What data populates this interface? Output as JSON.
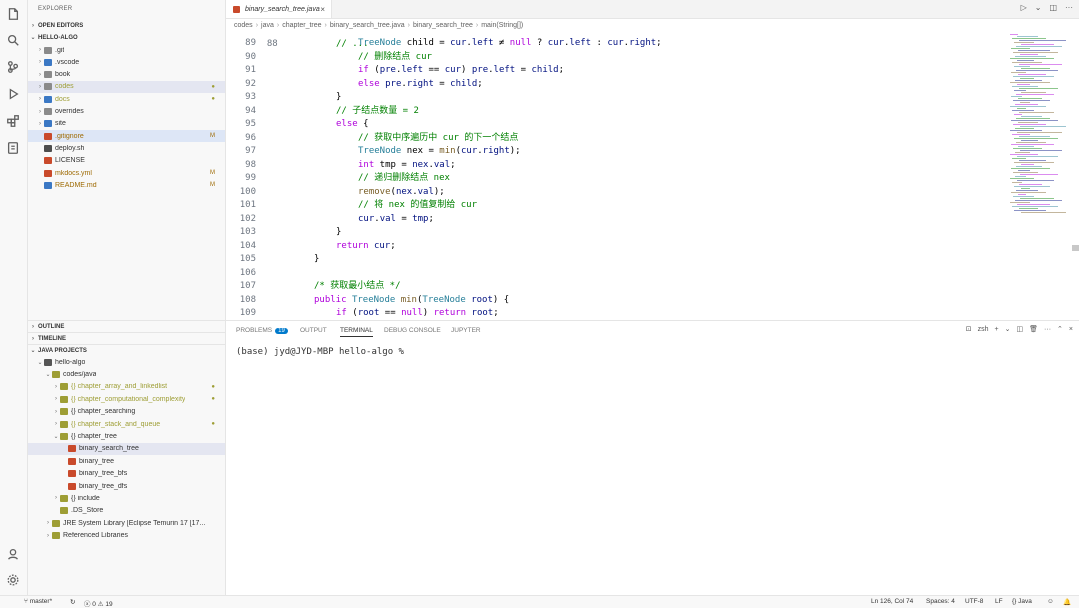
{
  "sidebar": {
    "title": "EXPLORER",
    "open_editors": "OPEN EDITORS",
    "root": "HELLO-ALGO",
    "files": [
      {
        "name": ".git",
        "kind": "folder",
        "badge": "",
        "color": "#8a8a8a",
        "badge_color": ""
      },
      {
        "name": ".vscode",
        "kind": "folder",
        "badge": "",
        "color": "#3b78c4",
        "badge_color": ""
      },
      {
        "name": "book",
        "kind": "folder",
        "badge": "",
        "color": "#8a8a8a",
        "badge_color": ""
      },
      {
        "name": "codes",
        "kind": "folder",
        "badge": "●",
        "color": "#8a8a8a",
        "badge_color": "#9e9e35"
      },
      {
        "name": "docs",
        "kind": "folder",
        "badge": "●",
        "color": "#3b78c4",
        "badge_color": "#9e9e35"
      },
      {
        "name": "overrides",
        "kind": "folder",
        "badge": "",
        "color": "#8a8a8a",
        "badge_color": ""
      },
      {
        "name": "site",
        "kind": "folder",
        "badge": "",
        "color": "#3b78c4",
        "badge_color": ""
      },
      {
        "name": ".gitignore",
        "kind": "file",
        "badge": "M",
        "color": "#c94a2b",
        "badge_color": "#9e6a03"
      },
      {
        "name": "deploy.sh",
        "kind": "file",
        "badge": "",
        "color": "#4d4d4d",
        "badge_color": ""
      },
      {
        "name": "LICENSE",
        "kind": "file",
        "badge": "",
        "color": "#c94a2b",
        "badge_color": ""
      },
      {
        "name": "mkdocs.yml",
        "kind": "file",
        "badge": "M",
        "color": "#c94a2b",
        "badge_color": "#9e6a03"
      },
      {
        "name": "README.md",
        "kind": "file",
        "badge": "M",
        "color": "#3b78c4",
        "badge_color": "#9e6a03"
      }
    ],
    "outline": "OUTLINE",
    "timeline": "TIMELINE",
    "java_projects": "JAVA PROJECTS",
    "projects": [
      {
        "name": "hello-algo",
        "level": 0,
        "chev": "⌄",
        "badge": ""
      },
      {
        "name": "codes/java",
        "level": 1,
        "chev": "⌄",
        "badge": ""
      },
      {
        "name": "{} chapter_array_and_linkedlist",
        "level": 2,
        "chev": "›",
        "badge": "●"
      },
      {
        "name": "{} chapter_computational_complexity",
        "level": 2,
        "chev": "›",
        "badge": "●"
      },
      {
        "name": "{} chapter_searching",
        "level": 2,
        "chev": "›",
        "badge": ""
      },
      {
        "name": "{} chapter_stack_and_queue",
        "level": 2,
        "chev": "›",
        "badge": "●"
      },
      {
        "name": "{} chapter_tree",
        "level": 2,
        "chev": "⌄",
        "badge": ""
      },
      {
        "name": "binary_search_tree",
        "level": 3,
        "chev": "",
        "badge": ""
      },
      {
        "name": "binary_tree",
        "level": 3,
        "chev": "",
        "badge": ""
      },
      {
        "name": "binary_tree_bfs",
        "level": 3,
        "chev": "",
        "badge": ""
      },
      {
        "name": "binary_tree_dfs",
        "level": 3,
        "chev": "",
        "badge": ""
      },
      {
        "name": "{} include",
        "level": 2,
        "chev": "›",
        "badge": ""
      },
      {
        "name": ".DS_Store",
        "level": 2,
        "chev": "",
        "badge": ""
      },
      {
        "name": "JRE System Library [Eclipse Temurin 17 [17...",
        "level": 1,
        "chev": "›",
        "badge": ""
      },
      {
        "name": "Referenced Libraries",
        "level": 1,
        "chev": "›",
        "badge": ""
      }
    ]
  },
  "editor": {
    "tab_label": "binary_search_tree.java",
    "tab_close": "×",
    "breadcrumb": [
      "codes",
      "java",
      "chapter_tree",
      "binary_search_tree.java",
      "binary_search_tree",
      "main(String[])"
    ],
    "lines": [
      {
        "n": "89",
        "i": 3,
        "t": [
          [
            "ty",
            "TreeNode"
          ],
          [
            "tx",
            " child = "
          ],
          [
            "vr",
            "cur"
          ],
          [
            "tx",
            "."
          ],
          [
            "vr",
            "left"
          ],
          [
            "tx",
            " ≠ "
          ],
          [
            "kw",
            "null"
          ],
          [
            "tx",
            " ? "
          ],
          [
            "vr",
            "cur"
          ],
          [
            "tx",
            "."
          ],
          [
            "vr",
            "left"
          ],
          [
            "tx",
            " : "
          ],
          [
            "vr",
            "cur"
          ],
          [
            "tx",
            "."
          ],
          [
            "vr",
            "right"
          ],
          [
            "tx",
            ";"
          ]
        ]
      },
      {
        "n": "90",
        "i": 3,
        "t": [
          [
            "cm",
            "// 删除结点 cur"
          ]
        ]
      },
      {
        "n": "91",
        "i": 3,
        "t": [
          [
            "kw",
            "if"
          ],
          [
            "tx",
            " ("
          ],
          [
            "vr",
            "pre"
          ],
          [
            "tx",
            "."
          ],
          [
            "vr",
            "left"
          ],
          [
            "tx",
            " == "
          ],
          [
            "vr",
            "cur"
          ],
          [
            "tx",
            ") "
          ],
          [
            "vr",
            "pre"
          ],
          [
            "tx",
            "."
          ],
          [
            "vr",
            "left"
          ],
          [
            "tx",
            " = "
          ],
          [
            "vr",
            "child"
          ],
          [
            "tx",
            ";"
          ]
        ]
      },
      {
        "n": "92",
        "i": 3,
        "t": [
          [
            "kw",
            "else"
          ],
          [
            "tx",
            " "
          ],
          [
            "vr",
            "pre"
          ],
          [
            "tx",
            "."
          ],
          [
            "vr",
            "right"
          ],
          [
            "tx",
            " = "
          ],
          [
            "vr",
            "child"
          ],
          [
            "tx",
            ";"
          ]
        ]
      },
      {
        "n": "93",
        "i": 2,
        "t": [
          [
            "tx",
            "}"
          ]
        ]
      },
      {
        "n": "94",
        "i": 2,
        "t": [
          [
            "cm",
            "// 子结点数量 = 2"
          ]
        ]
      },
      {
        "n": "95",
        "i": 2,
        "t": [
          [
            "kw",
            "else"
          ],
          [
            "tx",
            " {"
          ]
        ]
      },
      {
        "n": "96",
        "i": 3,
        "t": [
          [
            "cm",
            "// 获取中序遍历中 cur 的下一个结点"
          ]
        ]
      },
      {
        "n": "97",
        "i": 3,
        "t": [
          [
            "ty",
            "TreeNode"
          ],
          [
            "tx",
            " nex = "
          ],
          [
            "fn",
            "min"
          ],
          [
            "tx",
            "("
          ],
          [
            "vr",
            "cur"
          ],
          [
            "tx",
            "."
          ],
          [
            "vr",
            "right"
          ],
          [
            "tx",
            ");"
          ]
        ]
      },
      {
        "n": "98",
        "i": 3,
        "t": [
          [
            "kw",
            "int"
          ],
          [
            "tx",
            " tmp = "
          ],
          [
            "vr",
            "nex"
          ],
          [
            "tx",
            "."
          ],
          [
            "vr",
            "val"
          ],
          [
            "tx",
            ";"
          ]
        ]
      },
      {
        "n": "99",
        "i": 3,
        "t": [
          [
            "cm",
            "// 递归删除结点 nex"
          ]
        ]
      },
      {
        "n": "100",
        "i": 3,
        "t": [
          [
            "fn",
            "remove"
          ],
          [
            "tx",
            "("
          ],
          [
            "vr",
            "nex"
          ],
          [
            "tx",
            "."
          ],
          [
            "vr",
            "val"
          ],
          [
            "tx",
            ");"
          ]
        ]
      },
      {
        "n": "101",
        "i": 3,
        "t": [
          [
            "cm",
            "// 将 nex 的值复制给 cur"
          ]
        ]
      },
      {
        "n": "102",
        "i": 3,
        "t": [
          [
            "vr",
            "cur"
          ],
          [
            "tx",
            "."
          ],
          [
            "vr",
            "val"
          ],
          [
            "tx",
            " = "
          ],
          [
            "vr",
            "tmp"
          ],
          [
            "tx",
            ";"
          ]
        ]
      },
      {
        "n": "103",
        "i": 2,
        "t": [
          [
            "tx",
            "}"
          ]
        ]
      },
      {
        "n": "104",
        "i": 2,
        "t": [
          [
            "kw",
            "return"
          ],
          [
            "tx",
            " "
          ],
          [
            "vr",
            "cur"
          ],
          [
            "tx",
            ";"
          ]
        ]
      },
      {
        "n": "105",
        "i": 1,
        "t": [
          [
            "tx",
            "}"
          ]
        ]
      },
      {
        "n": "106",
        "i": 0,
        "t": []
      },
      {
        "n": "107",
        "i": 1,
        "t": [
          [
            "cm",
            "/* 获取最小结点 */"
          ]
        ]
      },
      {
        "n": "108",
        "i": 1,
        "t": [
          [
            "kw",
            "public"
          ],
          [
            "tx",
            " "
          ],
          [
            "ty",
            "TreeNode"
          ],
          [
            "tx",
            " "
          ],
          [
            "fn",
            "min"
          ],
          [
            "tx",
            "("
          ],
          [
            "ty",
            "TreeNode"
          ],
          [
            "tx",
            " "
          ],
          [
            "vr",
            "root"
          ],
          [
            "tx",
            ") {"
          ]
        ]
      },
      {
        "n": "109",
        "i": 2,
        "t": [
          [
            "kw",
            "if"
          ],
          [
            "tx",
            " ("
          ],
          [
            "vr",
            "root"
          ],
          [
            "tx",
            " == "
          ],
          [
            "kw",
            "null"
          ],
          [
            "tx",
            ") "
          ],
          [
            "kw",
            "return"
          ],
          [
            "tx",
            " "
          ],
          [
            "vr",
            "root"
          ],
          [
            "tx",
            ";"
          ]
        ]
      }
    ]
  },
  "panel": {
    "tabs": [
      "PROBLEMS",
      "OUTPUT",
      "TERMINAL",
      "DEBUG CONSOLE",
      "JUPYTER"
    ],
    "problems_count": "19",
    "active_tab": "TERMINAL",
    "shell": "zsh",
    "prompt": "(base) jyd@JYD-MBP hello-algo %"
  },
  "status": {
    "branch": "master*",
    "problems": "ⓧ 0 ⚠ 19",
    "cursor": "Ln 126, Col 74",
    "spaces": "Spaces: 4",
    "encoding": "UTF-8",
    "eol": "LF",
    "language": "Java"
  },
  "colors": {
    "accent": "#007acc",
    "folder": "#8a8a8a",
    "java_icon": "#c94a2b"
  }
}
